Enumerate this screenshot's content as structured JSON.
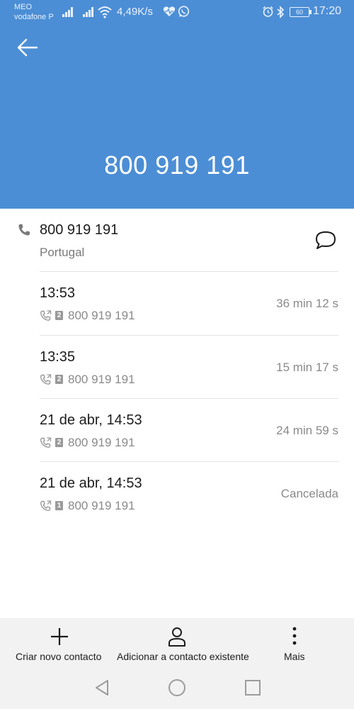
{
  "status_bar": {
    "carrier_1": "MEO",
    "carrier_2": "vodafone P",
    "net_speed": "4,49K/s",
    "battery": "60",
    "time": "17:20"
  },
  "header": {
    "phone_number": "800 919 191",
    "color": "#4c8ed5"
  },
  "contact": {
    "number": "800 919 191",
    "country": "Portugal"
  },
  "calls": [
    {
      "time": "13:53",
      "sim": "2",
      "number": "800 919 191",
      "duration": "36 min 12 s"
    },
    {
      "time": "13:35",
      "sim": "2",
      "number": "800 919 191",
      "duration": "15 min 17 s"
    },
    {
      "time": "21 de abr, 14:53",
      "sim": "2",
      "number": "800 919 191",
      "duration": "24 min 59 s"
    },
    {
      "time": "21 de abr, 14:53",
      "sim": "1",
      "number": "800 919 191",
      "duration": "Cancelada"
    }
  ],
  "actions": {
    "create": "Criar novo contacto",
    "add_existing": "Adicionar a contacto existente",
    "more": "Mais"
  },
  "icons": [
    "back-arrow-icon",
    "phone-icon",
    "message-icon",
    "plus-icon",
    "person-icon",
    "more-vertical-icon",
    "nav-back-icon",
    "nav-home-icon",
    "nav-recents-icon"
  ]
}
